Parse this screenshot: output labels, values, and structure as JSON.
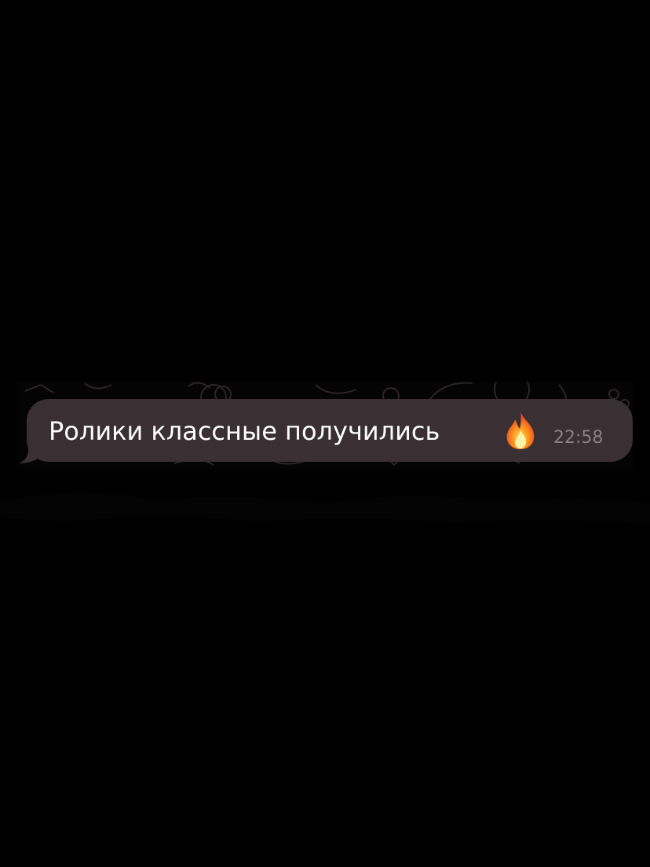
{
  "message": {
    "text": "Ролики классные получились",
    "emoji_icon": "fire-icon",
    "time": "22:58"
  },
  "colors": {
    "background": "#000000",
    "bubble": "#3a3034",
    "text": "#ffffff",
    "timestamp": "#8a7f84",
    "pattern": "#2a2226"
  }
}
